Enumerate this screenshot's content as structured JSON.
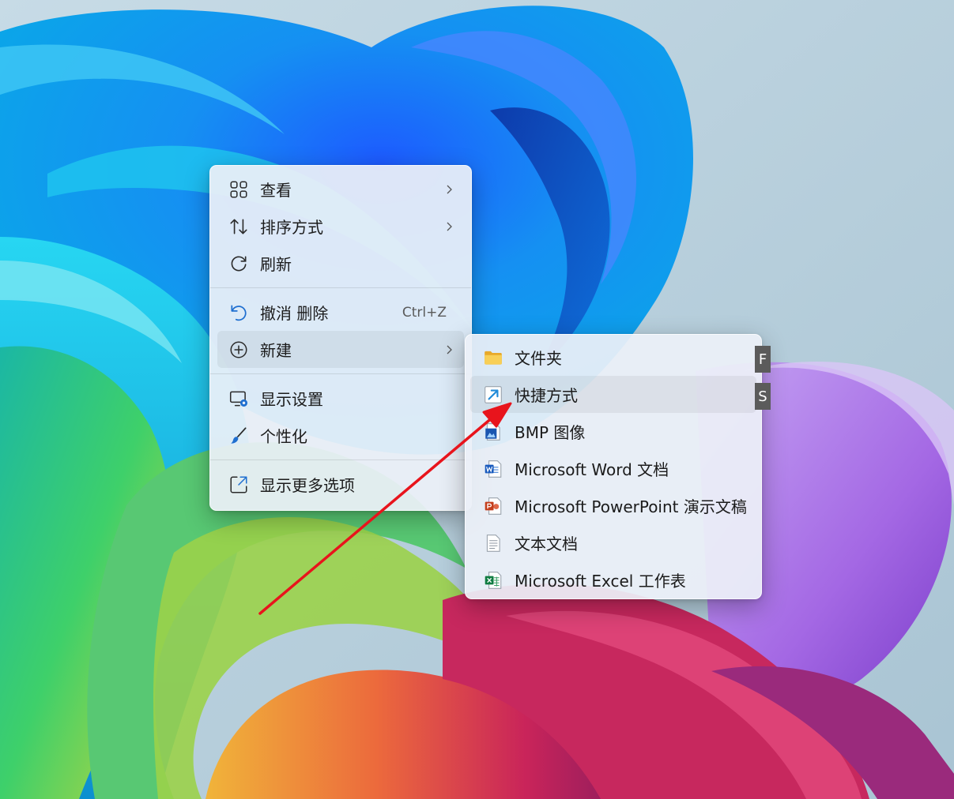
{
  "main_menu": {
    "items": [
      {
        "label": "查看",
        "icon": "grid-icon",
        "has_submenu": true
      },
      {
        "label": "排序方式",
        "icon": "sort-icon",
        "has_submenu": true
      },
      {
        "label": "刷新",
        "icon": "refresh-icon",
        "has_submenu": false
      },
      {
        "label": "撤消 删除",
        "icon": "undo-icon",
        "shortcut": "Ctrl+Z"
      },
      {
        "label": "新建",
        "icon": "plus-circle-icon",
        "has_submenu": true,
        "highlighted": true
      },
      {
        "label": "显示设置",
        "icon": "display-settings-icon"
      },
      {
        "label": "个性化",
        "icon": "brush-icon"
      },
      {
        "label": "显示更多选项",
        "icon": "more-options-icon"
      }
    ]
  },
  "new_submenu": {
    "items": [
      {
        "label": "文件夹",
        "icon": "folder-icon",
        "accelerator": "F"
      },
      {
        "label": "快捷方式",
        "icon": "shortcut-icon",
        "accelerator": "S",
        "highlighted": true
      },
      {
        "label": "BMP 图像",
        "icon": "bmp-image-icon"
      },
      {
        "label": "Microsoft Word 文档",
        "icon": "word-icon"
      },
      {
        "label": "Microsoft PowerPoint 演示文稿",
        "icon": "powerpoint-icon"
      },
      {
        "label": "文本文档",
        "icon": "text-document-icon"
      },
      {
        "label": "Microsoft Excel 工作表",
        "icon": "excel-icon"
      }
    ]
  },
  "colors": {
    "accent": "#0067c0",
    "annotation_arrow": "#e8141c",
    "folder": "#f4c34b",
    "word": "#185abd",
    "powerpoint": "#c43e1c",
    "excel": "#107c41"
  }
}
